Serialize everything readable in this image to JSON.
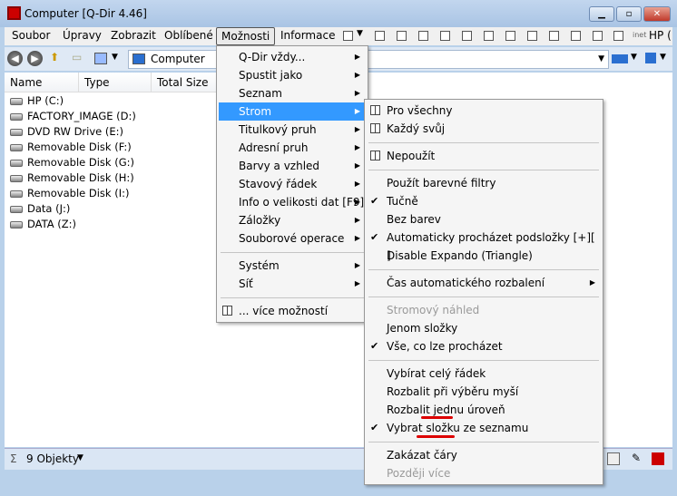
{
  "window": {
    "title": "Computer  [Q-Dir 4.46]"
  },
  "menubar": [
    "Soubor",
    "Úpravy",
    "Zobrazit",
    "Oblíbené",
    "Možnosti",
    "Informace"
  ],
  "toolbar_right": {
    "inet": "inet",
    "drive": "HP ("
  },
  "address": {
    "value": "Computer"
  },
  "columns": [
    "Name",
    "Type",
    "Total Size"
  ],
  "drives": [
    "HP (C:)",
    "FACTORY_IMAGE (D:)",
    "DVD RW Drive (E:)",
    "Removable Disk (F:)",
    "Removable Disk (G:)",
    "Removable Disk (H:)",
    "Removable Disk (I:)",
    "Data (J:)",
    "DATA (Z:)"
  ],
  "status": {
    "count": "9 Objekty",
    "sigma": "Σ"
  },
  "main_menu": [
    {
      "label": "Q-Dir vždy...",
      "sub": true
    },
    {
      "label": "Spustit jako",
      "sub": true
    },
    {
      "label": "Seznam",
      "sub": true
    },
    {
      "label": "Strom",
      "sub": true,
      "hl": true
    },
    {
      "label": "Titulkový pruh",
      "sub": true
    },
    {
      "label": "Adresní pruh",
      "sub": true
    },
    {
      "label": "Barvy a vzhled",
      "sub": true
    },
    {
      "label": "Stavový řádek",
      "sub": true
    },
    {
      "label": "Info o velikosti dat  [F9]",
      "sub": true
    },
    {
      "label": "Záložky",
      "sub": true
    },
    {
      "label": "Souborové operace",
      "sub": true
    },
    {
      "sep": true
    },
    {
      "label": "Systém",
      "sub": true
    },
    {
      "label": "Síť",
      "sub": true
    },
    {
      "sep": true
    },
    {
      "label": "... více možností",
      "icon": true
    }
  ],
  "sub_menu": [
    {
      "label": "Pro všechny",
      "icon": true
    },
    {
      "label": "Každý svůj",
      "icon": true
    },
    {
      "sep": true
    },
    {
      "label": "Nepoužít",
      "icon": true
    },
    {
      "sep": true
    },
    {
      "label": "Použít barevné filtry"
    },
    {
      "label": "Tučně",
      "check": true
    },
    {
      "label": "Bez barev"
    },
    {
      "label": "Automaticky procházet podsložky  [+][ ]",
      "check": true
    },
    {
      "label": "Disable Expando (Triangle)"
    },
    {
      "sep": true
    },
    {
      "label": "Čas automatického rozbalení",
      "sub": true
    },
    {
      "sep": true
    },
    {
      "label": "Stromový náhled",
      "dis": true
    },
    {
      "label": "Jenom složky"
    },
    {
      "label": "Vše, co lze procházet",
      "check": true
    },
    {
      "sep": true
    },
    {
      "label": "Vybírat celý řádek"
    },
    {
      "label": "Rozbalit při výběru myší"
    },
    {
      "label": "Rozbalit jednu úroveň"
    },
    {
      "label": "Vybrat složku ze seznamu",
      "check": true
    },
    {
      "sep": true
    },
    {
      "label": "Zakázat čáry"
    },
    {
      "label": "Později více",
      "dis": true
    }
  ],
  "colors": {
    "highlight": "#3399ff",
    "annotation": "#dd0000"
  }
}
